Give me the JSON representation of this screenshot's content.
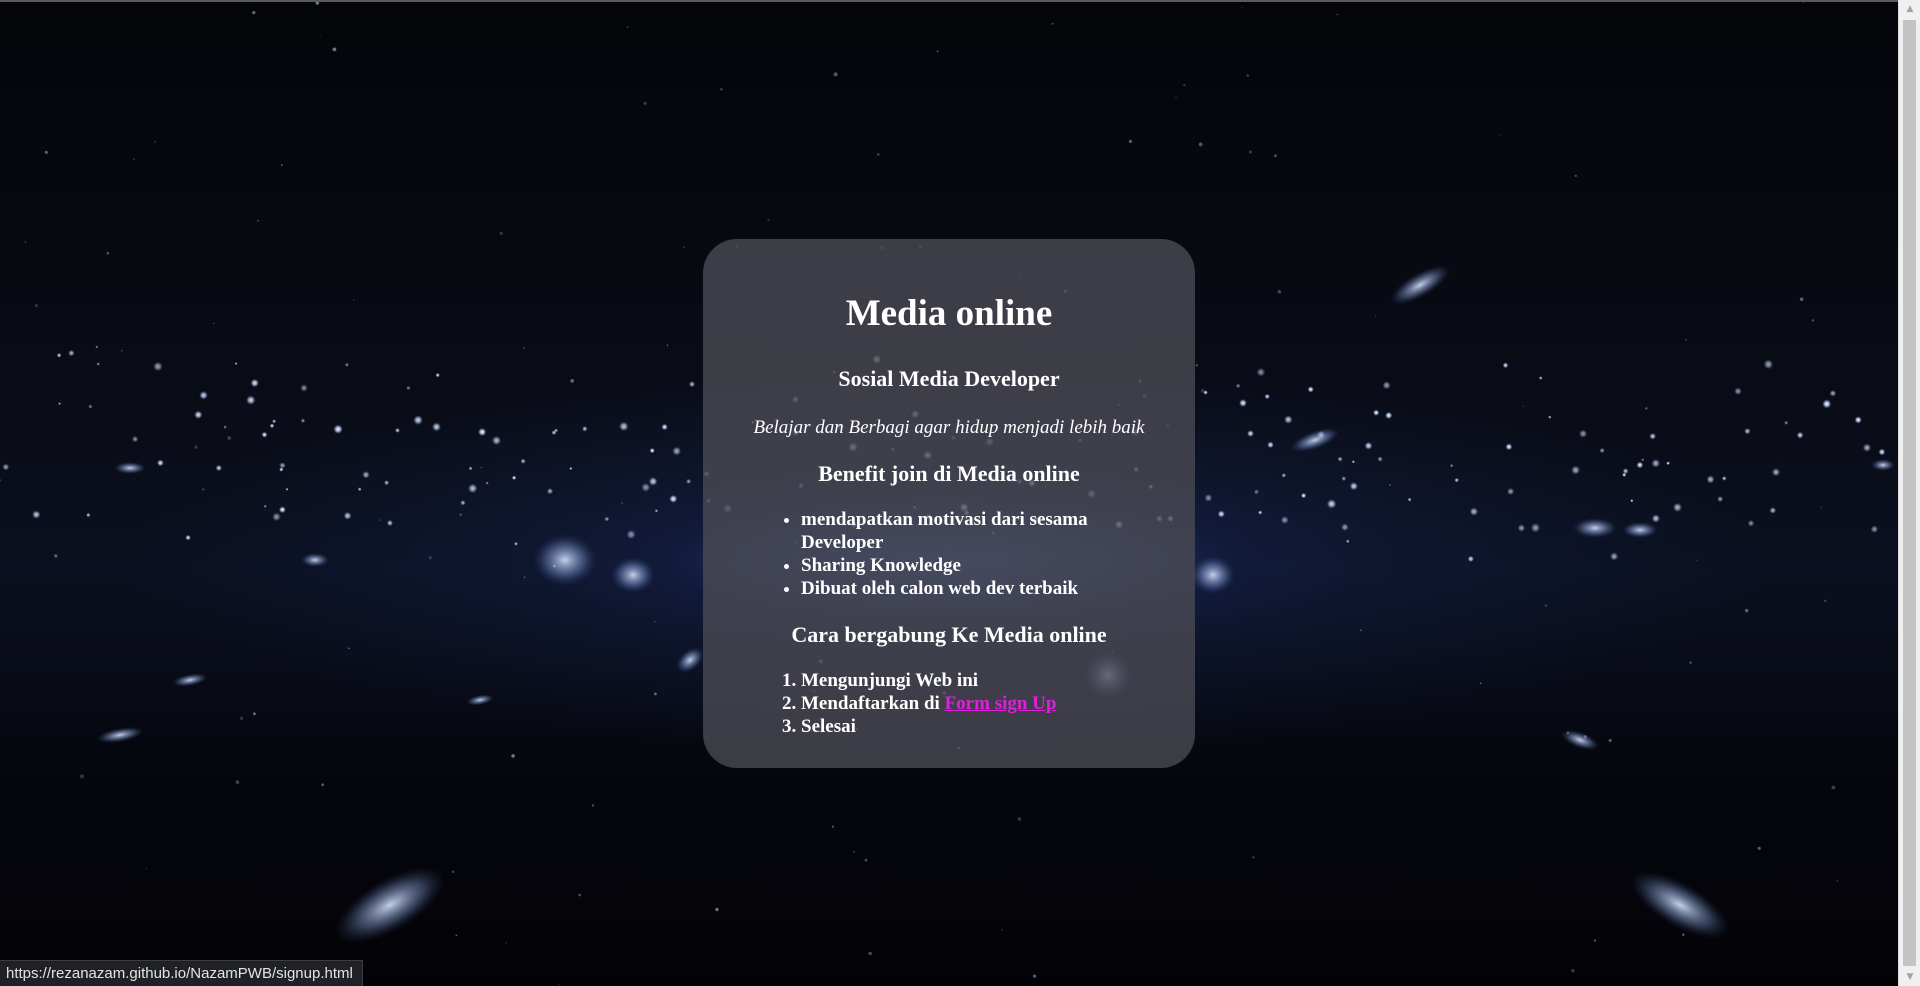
{
  "card": {
    "title": "Media online",
    "subtitle": "Sosial Media Developer",
    "tagline": "Belajar dan Berbagi agar hidup menjadi lebih baik",
    "benefit_heading": "Benefit join di Media online",
    "benefits": [
      "mendapatkan motivasi dari sesama Developer",
      "Sharing Knowledge",
      "Dibuat oleh calon web dev terbaik"
    ],
    "join_heading": "Cara bergabung Ke Media online",
    "steps": {
      "step1": "Mengunjungi Web ini",
      "step2_prefix": "Mendaftarkan di ",
      "step2_link": "Form sign Up",
      "step3": "Selesai"
    }
  },
  "status_bar": {
    "url": "https://rezanazam.github.io/NazamPWB/signup.html"
  },
  "colors": {
    "link": "#e21ee0",
    "card_bg": "rgba(75,76,84,0.78)",
    "text": "#ffffff"
  },
  "icons": {
    "list_bullet": "disc",
    "scroll_up": "triangle-up",
    "scroll_down": "triangle-down"
  }
}
